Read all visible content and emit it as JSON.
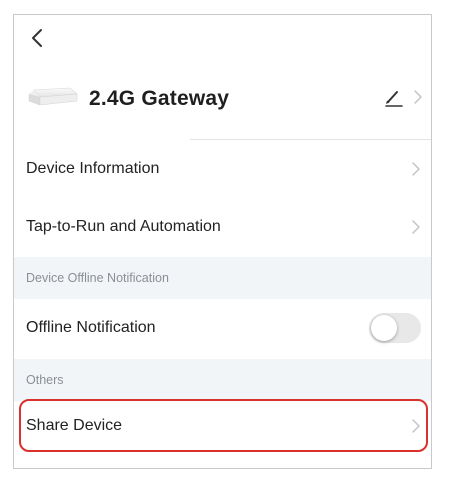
{
  "device": {
    "name": "2.4G Gateway",
    "icon": "gateway-device-image"
  },
  "rows": {
    "device_information": "Device Information",
    "tap_to_run": "Tap-to-Run and Automation",
    "offline_notification": "Offline Notification",
    "share_device": "Share Device"
  },
  "sections": {
    "offline": "Device Offline Notification",
    "others": "Others"
  },
  "toggle": {
    "offline_notification_on": false
  },
  "icons": {
    "back": "chevron-left-icon",
    "edit": "pencil-icon",
    "row_arrow": "chevron-right-icon"
  },
  "colors": {
    "highlight": "#d9322c",
    "section_bg": "#f2f5f8",
    "section_text": "#8a8f95",
    "toggle_off": "#e8e8e8"
  }
}
